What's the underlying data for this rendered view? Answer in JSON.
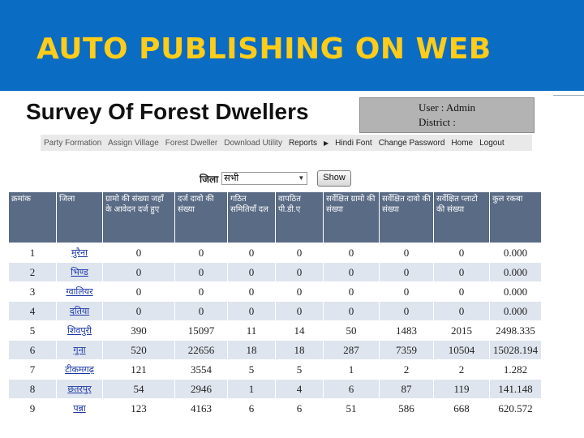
{
  "slide": {
    "title": "AUTO PUBLISHING ON WEB"
  },
  "app": {
    "title": "Survey Of Forest Dwellers",
    "user_line": "User : Admin",
    "district_line": "District :"
  },
  "menu": {
    "items": [
      "Party Formation",
      "Assign Village",
      "Forest Dweller",
      "Download Utility",
      "Reports",
      "Hindi Font",
      "Change Password",
      "Home",
      "Logout"
    ]
  },
  "filter": {
    "label": "जिला",
    "selected": "सभी",
    "show_label": "Show"
  },
  "table": {
    "headers": [
      "क्रमांक",
      "जिला",
      "ग्रामो की संख्या जहाँ के आवेदन दर्ज हुए",
      "दर्ज दावो की संख्या",
      "गठित समितियाँ दल",
      "वापठित पी.डी.ए",
      "सर्वेक्षित ग्रामो की संख्या",
      "सर्वेक्षित दावो की संख्या",
      "सर्वेक्षित प्लाटो की संख्या",
      "कुल रकबा"
    ],
    "rows": [
      [
        "1",
        "मुरैना",
        "0",
        "0",
        "0",
        "0",
        "0",
        "0",
        "0",
        "0.000"
      ],
      [
        "2",
        "भिण्ड",
        "0",
        "0",
        "0",
        "0",
        "0",
        "0",
        "0",
        "0.000"
      ],
      [
        "3",
        "ग्वालियर",
        "0",
        "0",
        "0",
        "0",
        "0",
        "0",
        "0",
        "0.000"
      ],
      [
        "4",
        "दतिया",
        "0",
        "0",
        "0",
        "0",
        "0",
        "0",
        "0",
        "0.000"
      ],
      [
        "5",
        "शिवपुरी",
        "390",
        "15097",
        "11",
        "14",
        "50",
        "1483",
        "2015",
        "2498.335"
      ],
      [
        "6",
        "गुना",
        "520",
        "22656",
        "18",
        "18",
        "287",
        "7359",
        "10504",
        "15028.194"
      ],
      [
        "7",
        "टीकमगढ़",
        "121",
        "3554",
        "5",
        "5",
        "1",
        "2",
        "2",
        "1.282"
      ],
      [
        "8",
        "छतरपुर",
        "54",
        "2946",
        "1",
        "4",
        "6",
        "87",
        "119",
        "141.148"
      ],
      [
        "9",
        "पन्ना",
        "123",
        "4163",
        "6",
        "6",
        "51",
        "586",
        "668",
        "620.572"
      ]
    ]
  }
}
